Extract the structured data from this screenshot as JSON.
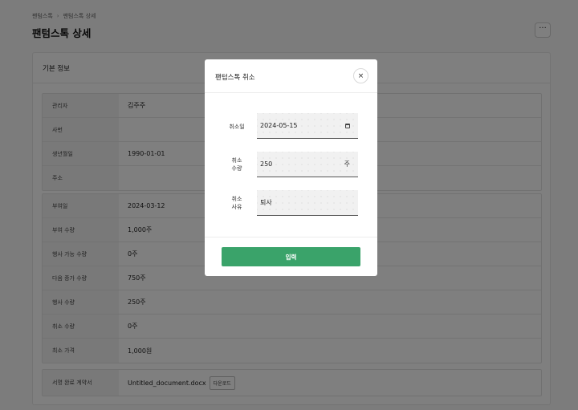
{
  "breadcrumb": [
    "팬텀스톡",
    "팬텀스톡 상세"
  ],
  "breadcrumb_sep": "›",
  "page_title": "팬텀스톡 상세",
  "more_button": "···",
  "card": {
    "title": "기본 정보",
    "section1": [
      {
        "label": "관리자",
        "value": "김주주"
      },
      {
        "label": "사번",
        "value": ""
      },
      {
        "label": "생년월일",
        "value": "1990-01-01"
      },
      {
        "label": "주소",
        "value": ""
      }
    ],
    "section2": [
      {
        "label": "부여일",
        "value": "2024-03-12"
      },
      {
        "label": "부여 수량",
        "value": "1,000주"
      },
      {
        "label": "행사 가능 수량",
        "value": "0주"
      },
      {
        "label": "다음 증가 수량",
        "value": "750주"
      },
      {
        "label": "행사 수량",
        "value": "250주"
      },
      {
        "label": "취소 수량",
        "value": "0주"
      },
      {
        "label": "최소 가격",
        "value": "1,000원"
      }
    ],
    "section3": {
      "label": "서명 완료 계약서",
      "value": "Untitled_document.docx",
      "button": "다운로드"
    }
  },
  "modal": {
    "title": "팬텀스톡 취소",
    "close_icon": "×",
    "fields": {
      "date": {
        "label": "취소일",
        "value": "2024-05-15"
      },
      "qty": {
        "label_line1": "취소",
        "label_line2": "수량",
        "value": "250",
        "suffix": "주"
      },
      "reason": {
        "label_line1": "취소",
        "label_line2": "사유",
        "value": "퇴사"
      }
    },
    "submit_label": "입력",
    "accent_color": "#3aa36a"
  }
}
